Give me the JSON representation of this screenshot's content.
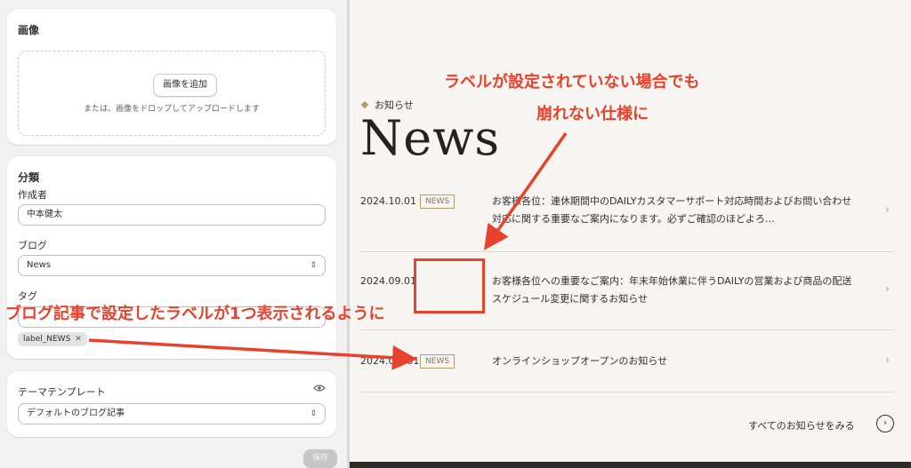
{
  "image_card": {
    "title": "画像",
    "add_button": "画像を追加",
    "drop_hint": "または、画像をドロップしてアップロードします"
  },
  "classification": {
    "title": "分類",
    "author_label": "作成者",
    "author_value": "中本健太",
    "blog_label": "ブログ",
    "blog_value": "News",
    "tags_label": "タグ",
    "tag_chip": "label_NEWS"
  },
  "template_card": {
    "title": "テーマテンプレート",
    "value": "デフォルトのブログ記事"
  },
  "save_button": "保存",
  "preview": {
    "kicker": "お知らせ",
    "title": "News",
    "rows": [
      {
        "date": "2024.10.01",
        "badge": "NEWS",
        "text": "お客様各位：連休期間中のDAILYカスタマーサポート対応時間およびお問い合わせ対応に関する重要なご案内になります。必ずご確認のほどよろ…"
      },
      {
        "date": "2024.09.01",
        "badge": "",
        "text": "お客様各位への重要なご案内：年末年始休業に伴うDAILYの営業および商品の配送スケジュール変更に関するお知らせ"
      },
      {
        "date": "2024.0■.01",
        "badge": "NEWS",
        "text": "オンラインショップオープンのお知らせ"
      }
    ],
    "see_all": "すべてのお知らせをみる"
  },
  "annotations": {
    "top_line1": "ラベルが設定されていない場合でも",
    "top_line2": "崩れない仕様に",
    "middle": "ブログ記事で設定したラベルが1つ表示されるように"
  },
  "colors": {
    "annotation": "#e8412c",
    "badge_border": "#b59a6a"
  }
}
